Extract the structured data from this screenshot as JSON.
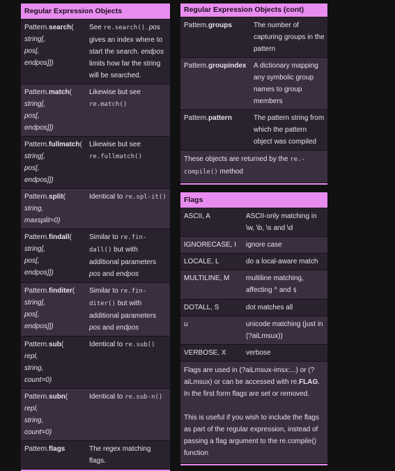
{
  "left": {
    "title": "Regular Expression Objects",
    "rows": [
      {
        "name": "search",
        "args": [
          "string[,",
          "pos[,",
          "endpos]])"
        ],
        "desc": [
          {
            "t": "See "
          },
          {
            "m": "re.search()"
          },
          {
            "t": ". "
          },
          {
            "i": "pos"
          },
          {
            "t": " gives an index where to start the search. "
          },
          {
            "i": "endpos"
          },
          {
            "t": " limits how far the string will be searched."
          }
        ]
      },
      {
        "name": "match",
        "args": [
          "string[,",
          "pos[,",
          "endpos]])"
        ],
        "desc": [
          {
            "t": "Likewise but see "
          },
          {
            "m": "re.match()"
          }
        ]
      },
      {
        "name": "fullmatch",
        "args": [
          "string[,",
          "pos[,",
          "endpos]])"
        ],
        "desc": [
          {
            "t": "Likewise but see "
          },
          {
            "m": "re.fullmatch()"
          }
        ]
      },
      {
        "name": "split",
        "args": [
          "string,",
          "maxsplit=0)"
        ],
        "desc": [
          {
            "t": "Identical to "
          },
          {
            "m": "re.spl-it()"
          }
        ]
      },
      {
        "name": "findall",
        "args": [
          "string[,",
          "pos[,",
          "endpos]])"
        ],
        "desc": [
          {
            "t": "Similar to "
          },
          {
            "m": "re.fin-dall()"
          },
          {
            "t": " but with additional parameters "
          },
          {
            "i": "pos"
          },
          {
            "t": " and "
          },
          {
            "i": "endpos"
          }
        ]
      },
      {
        "name": "finditer",
        "args": [
          "string[,",
          "pos[,",
          "endpos]])"
        ],
        "desc": [
          {
            "t": "Similar to "
          },
          {
            "m": "re.fin-diter()"
          },
          {
            "t": " but with additional parameters "
          },
          {
            "i": "pos"
          },
          {
            "t": " and "
          },
          {
            "i": "endpos"
          }
        ]
      },
      {
        "name": "sub",
        "args": [
          "repl,",
          "string,",
          "count=0)"
        ],
        "desc": [
          {
            "t": "Identical to "
          },
          {
            "m": "re.sub()"
          }
        ]
      },
      {
        "name": "subn",
        "args": [
          "repl,",
          "string,",
          "count=0)"
        ],
        "desc": [
          {
            "t": "Identical to "
          },
          {
            "m": "re.sub-n()"
          }
        ]
      },
      {
        "name": "flags",
        "args": [],
        "desc": [
          {
            "t": "The regex matching flags."
          }
        ]
      }
    ]
  },
  "right": {
    "title": "Regular Expression Objects (cont)",
    "rows": [
      {
        "name": "groups",
        "desc": "The number of capturing groups in the pattern"
      },
      {
        "name": "groupindex",
        "desc": "A dictionary mapping any symbolic group names to group members"
      },
      {
        "name": "pattern",
        "desc": "The pattern string from which the pattern object was compiled"
      }
    ],
    "note": [
      {
        "t": "These objects are returned by the "
      },
      {
        "m": "re.-compile()"
      },
      {
        "t": " method"
      }
    ]
  },
  "flags": {
    "title": "Flags",
    "rows": [
      {
        "flag": "ASCII, A",
        "desc": "ASCII-only matching in \\w, \\b, \\s and \\d"
      },
      {
        "flag": "IGNORECASE, I",
        "desc": "ignore case"
      },
      {
        "flag": "LOCALE, L",
        "desc": "do a local-aware match"
      },
      {
        "flag": "MULTILINE, M",
        "desc": [
          {
            "t": "multiline matching, affecting ^ and "
          },
          {
            "m": "$"
          }
        ]
      },
      {
        "flag": "DOTALL, S",
        "desc": "dot matches all"
      },
      {
        "flag": "u",
        "desc": "unicode matching (just in (?aiLmsux))"
      },
      {
        "flag": "VERBOSE, X",
        "desc": "verbose"
      }
    ],
    "note1": [
      {
        "t": "Flags are used in (?aiLmsux-imsx:...) or (?aiLmsux) or can be accessed with re."
      },
      {
        "b": "FLAG"
      },
      {
        "t": ". In the first form flags are set or removed."
      }
    ],
    "note2": "This is useful if you wish to include the flags as part of the regular expression, instead of passing a flag argument to the re.compile() function"
  },
  "prefix": "Pattern."
}
